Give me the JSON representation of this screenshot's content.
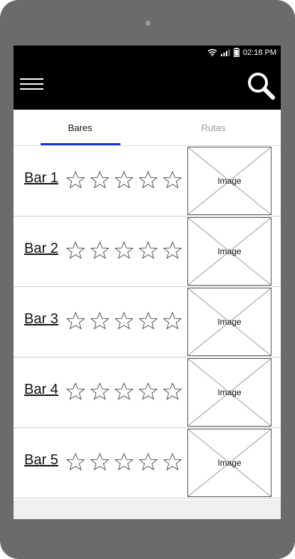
{
  "status": {
    "time": "02:18 PM"
  },
  "tabs": [
    {
      "label": "Bares",
      "active": true
    },
    {
      "label": "Rutas",
      "active": false
    }
  ],
  "bars": [
    {
      "name": "Bar 1",
      "rating": 0,
      "image_label": "Image"
    },
    {
      "name": "Bar 2",
      "rating": 0,
      "image_label": "Image"
    },
    {
      "name": "Bar 3",
      "rating": 0,
      "image_label": "Image"
    },
    {
      "name": "Bar 4",
      "rating": 0,
      "image_label": "Image"
    },
    {
      "name": "Bar 5",
      "rating": 0,
      "image_label": "Image"
    }
  ],
  "max_stars": 5,
  "colors": {
    "tab_indicator": "#1736d6",
    "appbar": "#000000",
    "device": "#6b6b6b"
  },
  "icons": [
    "wifi-icon",
    "signal-icon",
    "battery-icon",
    "menu-icon",
    "search-icon",
    "star-outline-icon",
    "image-placeholder-icon"
  ]
}
